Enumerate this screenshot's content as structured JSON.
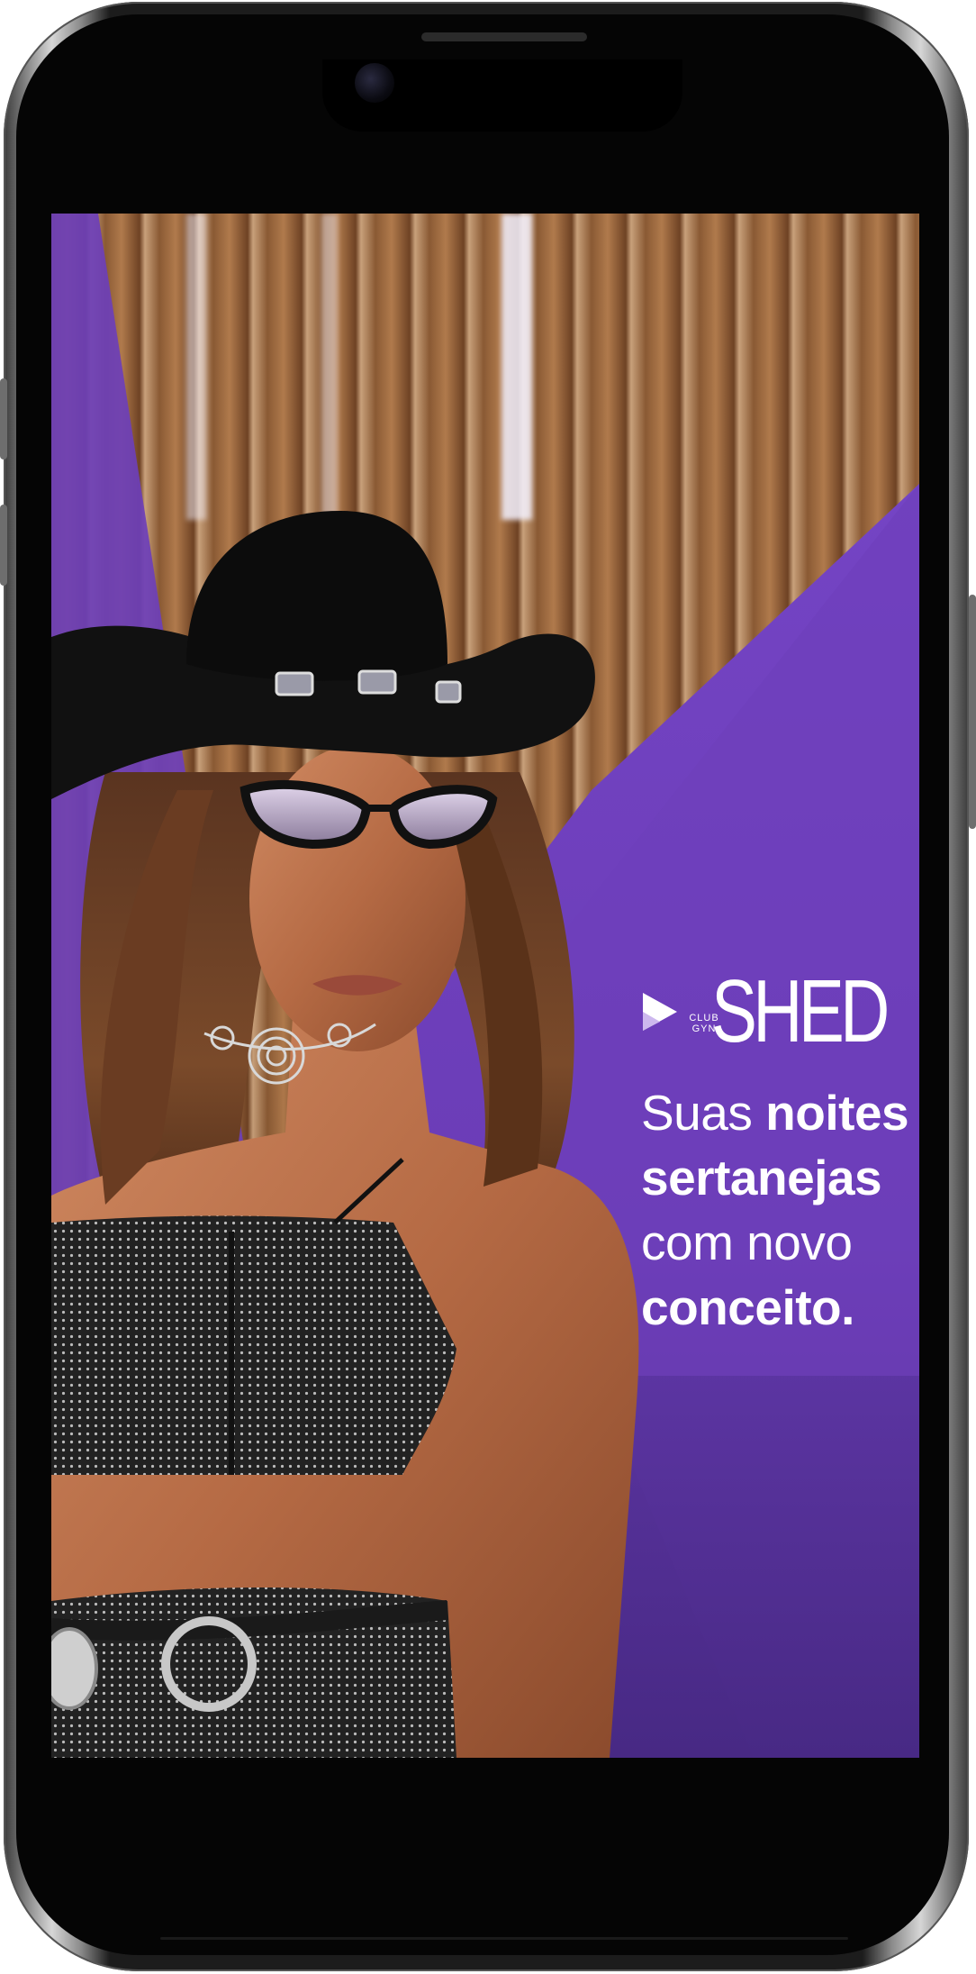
{
  "brand": {
    "name": "SHED",
    "sub_line1": "CLUB",
    "sub_line2": "GYN"
  },
  "tagline": {
    "line1_light": "Suas ",
    "line1_bold": "noites",
    "line2_bold": "sertanejas",
    "line3_light": "com novo",
    "line4_bold": "conceito."
  },
  "colors": {
    "brand_purple": "#6d3fb8",
    "text": "#ffffff",
    "device": "#050505"
  },
  "icons": {
    "logo_mark": "play-triangle-icon"
  }
}
